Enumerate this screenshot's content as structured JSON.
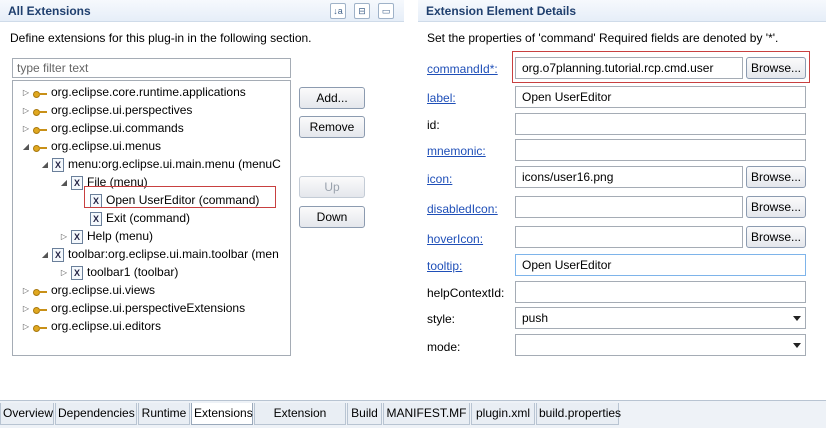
{
  "left": {
    "title": "All Extensions",
    "description": "Define extensions for this plug-in in the following section.",
    "filter_placeholder": "type filter text",
    "header_icons": [
      "sort-az-icon",
      "collapse-icon",
      "minimize-icon"
    ],
    "tree": [
      {
        "label": "org.eclipse.core.runtime.applications",
        "level": 0,
        "expanded": false,
        "icon": "extension-icon"
      },
      {
        "label": "org.eclipse.ui.perspectives",
        "level": 0,
        "expanded": false,
        "icon": "extension-icon"
      },
      {
        "label": "org.eclipse.ui.commands",
        "level": 0,
        "expanded": false,
        "icon": "extension-icon"
      },
      {
        "label": "org.eclipse.ui.menus",
        "level": 0,
        "expanded": true,
        "icon": "extension-icon"
      },
      {
        "label": "menu:org.eclipse.ui.main.menu (menuC",
        "level": 1,
        "expanded": true,
        "icon": "element-icon"
      },
      {
        "label": "File (menu)",
        "level": 2,
        "expanded": true,
        "icon": "element-icon"
      },
      {
        "label": "Open UserEditor (command)",
        "level": 3,
        "expanded": null,
        "icon": "element-icon",
        "selected": true
      },
      {
        "label": "Exit (command)",
        "level": 3,
        "expanded": null,
        "icon": "element-icon"
      },
      {
        "label": "Help (menu)",
        "level": 2,
        "expanded": false,
        "icon": "element-icon"
      },
      {
        "label": "toolbar:org.eclipse.ui.main.toolbar (men",
        "level": 1,
        "expanded": true,
        "icon": "element-icon"
      },
      {
        "label": "toolbar1 (toolbar)",
        "level": 2,
        "expanded": false,
        "icon": "element-icon"
      },
      {
        "label": "org.eclipse.ui.views",
        "level": 0,
        "expanded": false,
        "icon": "extension-icon"
      },
      {
        "label": "org.eclipse.ui.perspectiveExtensions",
        "level": 0,
        "expanded": false,
        "icon": "extension-icon"
      },
      {
        "label": "org.eclipse.ui.editors",
        "level": 0,
        "expanded": false,
        "icon": "extension-icon"
      }
    ],
    "buttons": {
      "add": "Add...",
      "remove": "Remove",
      "up": "Up",
      "down": "Down"
    }
  },
  "right": {
    "title": "Extension Element Details",
    "description": "Set the properties of 'command' Required fields are denoted by '*'.",
    "browse_label": "Browse...",
    "fields": {
      "commandId": {
        "label": "commandId*:",
        "value": "org.o7planning.tutorial.rcp.cmd.user"
      },
      "label": {
        "label": "label:",
        "value": "Open UserEditor"
      },
      "id": {
        "label": "id:",
        "value": ""
      },
      "mnemonic": {
        "label": "mnemonic:",
        "value": ""
      },
      "icon": {
        "label": "icon:",
        "value": "icons/user16.png"
      },
      "disabledIcon": {
        "label": "disabledIcon:",
        "value": ""
      },
      "hoverIcon": {
        "label": "hoverIcon:",
        "value": ""
      },
      "tooltip": {
        "label": "tooltip:",
        "value": "Open UserEditor"
      },
      "helpContextId": {
        "label": "helpContextId:",
        "value": ""
      },
      "style": {
        "label": "style:",
        "value": "push"
      },
      "mode": {
        "label": "mode:",
        "value": ""
      }
    }
  },
  "tabs": [
    "Overview",
    "Dependencies",
    "Runtime",
    "Extensions",
    "Extension Points",
    "Build",
    "MANIFEST.MF",
    "plugin.xml",
    "build.properties"
  ],
  "active_tab": "Extensions",
  "colors": {
    "header_text": "#1f3f6e",
    "link": "#1f4fb8",
    "highlight_border": "#c84040"
  }
}
